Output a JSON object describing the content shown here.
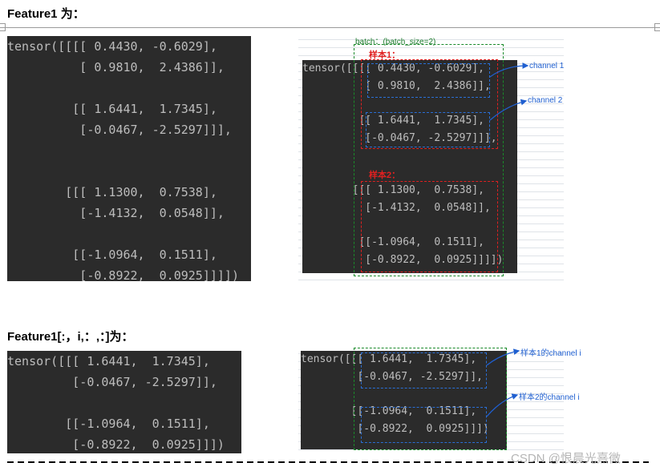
{
  "headings": {
    "first": "Feature1 为：",
    "second": "Feature1[:，i,：,：]为："
  },
  "code_full": "tensor([[[[ 0.4430, -0.6029],\n          [ 0.9810,  2.4386]],\n\n         [[ 1.6441,  1.7345],\n          [-0.0467, -2.5297]]],\n\n\n        [[[ 1.1300,  0.7538],\n          [-1.4132,  0.0548]],\n\n         [[-1.0964,  0.1511],\n          [-0.8922,  0.0925]]]])",
  "code_slice": "tensor([[[ 1.6441,  1.7345],\n         [-0.0467, -2.5297]],\n\n        [[-1.0964,  0.1511],\n         [-0.8922,  0.0925]]])",
  "annotations": {
    "batch": "batch：(batch_size=2)",
    "sample1": "样本1：",
    "sample2": "样本2：",
    "channel1": "channel 1",
    "channel2": "channel 2",
    "sample1_channel_i": "样本1的channel i",
    "sample2_channel_i": "样本2的channel i"
  },
  "watermark": "CSDN @恨晨光熹微",
  "colors": {
    "code_bg": "#2b2b2b",
    "code_text": "#bdbdbd",
    "batch_box": "#1a8a2a",
    "sample_box": "#e02020",
    "channel_box": "#2a6fd6"
  }
}
